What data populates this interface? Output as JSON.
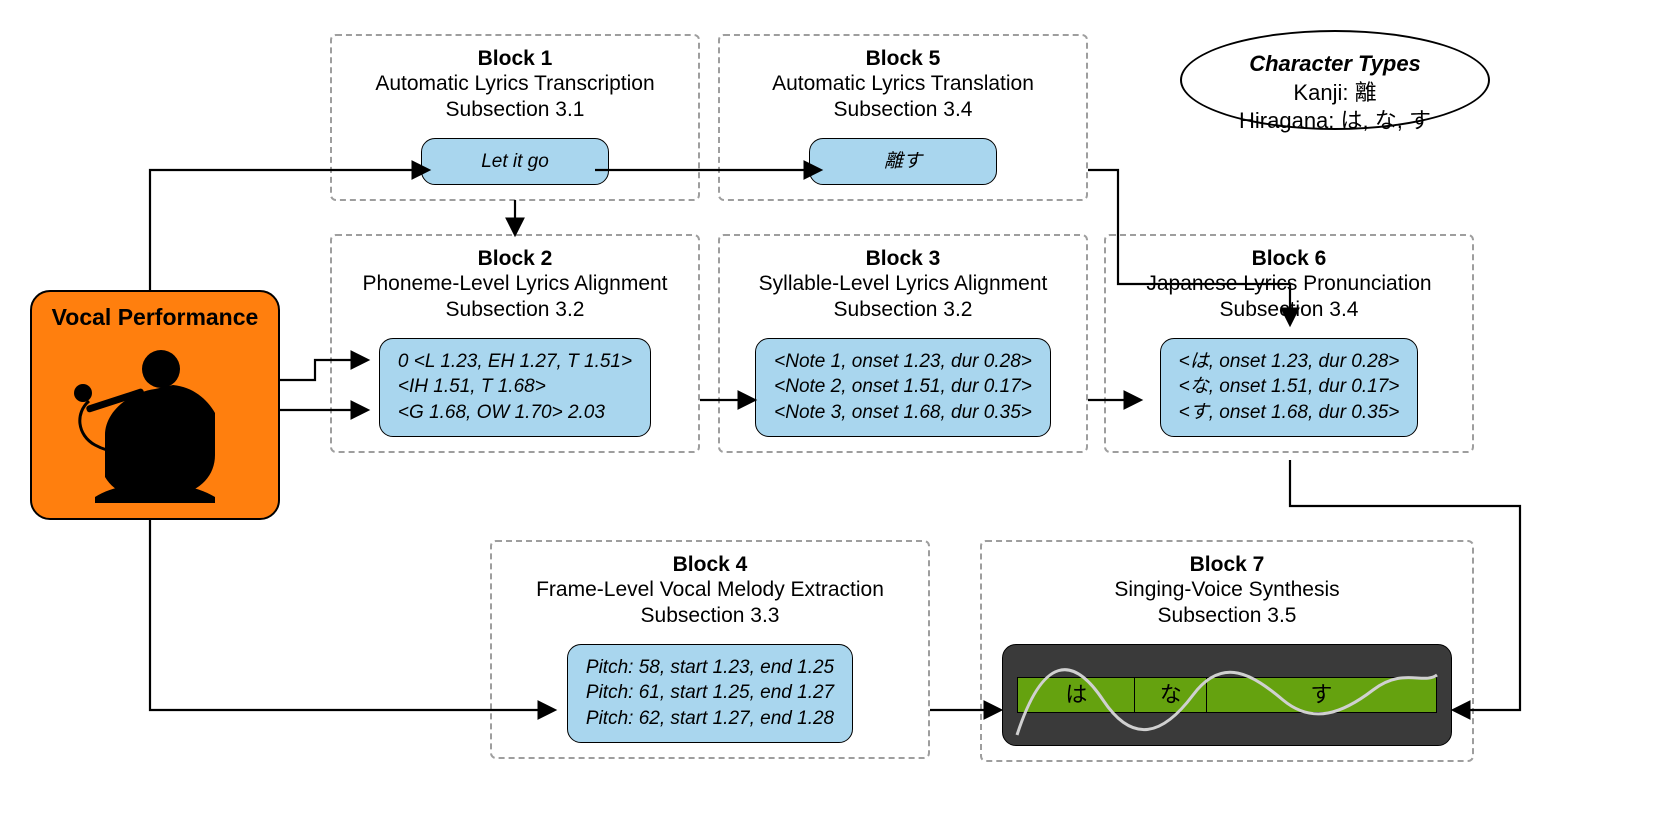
{
  "vocal": {
    "title": "Vocal Performance"
  },
  "legend": {
    "title": "Character Types",
    "line1": "Kanji: 離",
    "line2": "Hiragana: は, な, す"
  },
  "blocks": {
    "b1": {
      "name": "Block 1",
      "desc": "Automatic Lyrics Transcription",
      "sub": "Subsection 3.1",
      "payload": "Let it go"
    },
    "b5": {
      "name": "Block 5",
      "desc": "Automatic Lyrics Translation",
      "sub": "Subsection 3.4",
      "payload": "離す"
    },
    "b2": {
      "name": "Block 2",
      "desc": "Phoneme-Level Lyrics Alignment",
      "sub": "Subsection 3.2",
      "payload1": "0 <L 1.23, EH 1.27, T 1.51>",
      "payload2": "<IH 1.51, T 1.68>",
      "payload3": "<G 1.68, OW 1.70> 2.03"
    },
    "b3": {
      "name": "Block 3",
      "desc": "Syllable-Level Lyrics Alignment",
      "sub": "Subsection 3.2",
      "payload1": "<Note 1, onset 1.23, dur 0.28>",
      "payload2": "<Note 2, onset 1.51, dur 0.17>",
      "payload3": "<Note 3, onset 1.68, dur 0.35>"
    },
    "b6": {
      "name": "Block 6",
      "desc": "Japanese Lyrics Pronunciation",
      "sub": "Subsection 3.4",
      "payload1": "<は, onset 1.23, dur 0.28>",
      "payload2": "<な, onset 1.51, dur 0.17>",
      "payload3": "<す, onset 1.68, dur 0.35>"
    },
    "b4": {
      "name": "Block 4",
      "desc": "Frame-Level Vocal Melody Extraction",
      "sub": "Subsection 3.3",
      "payload1": "Pitch: 58, start 1.23, end 1.25",
      "payload2": "Pitch: 61, start 1.25, end 1.27",
      "payload3": "Pitch: 62, start 1.27, end 1.28"
    },
    "b7": {
      "name": "Block 7",
      "desc": "Singing-Voice Synthesis",
      "sub": "Subsection 3.5",
      "segments": {
        "s1": "は",
        "s2": "な",
        "s3": "す"
      }
    }
  }
}
